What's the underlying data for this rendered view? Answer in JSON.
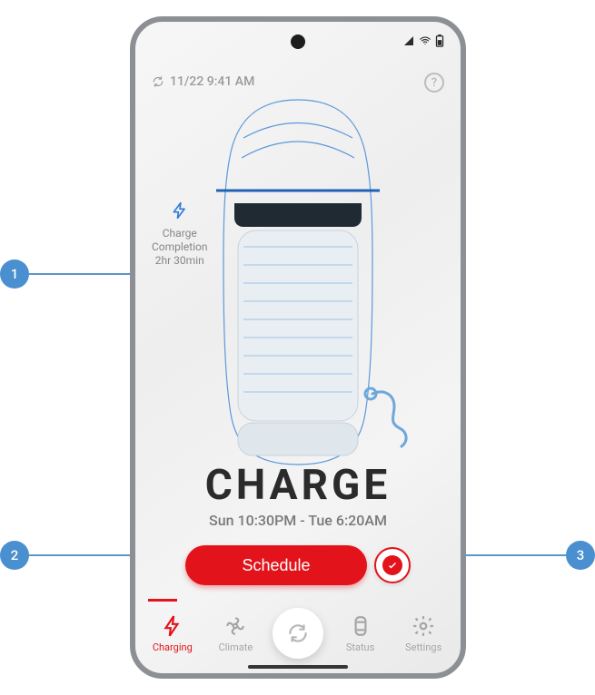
{
  "status": {
    "timestamp": "11/22 9:41 AM"
  },
  "charge_info": {
    "line1": "Charge",
    "line2": "Completion",
    "line3": "2hr 30min"
  },
  "main": {
    "title": "CHARGE",
    "schedule_range": "Sun 10:30PM - Tue 6:20AM"
  },
  "buttons": {
    "schedule_label": "Schedule"
  },
  "nav": {
    "items": [
      {
        "label": "Charging"
      },
      {
        "label": "Climate"
      },
      {
        "label": "Status"
      },
      {
        "label": "Settings"
      }
    ]
  },
  "callouts": {
    "one": "1",
    "two": "2",
    "three": "3"
  }
}
